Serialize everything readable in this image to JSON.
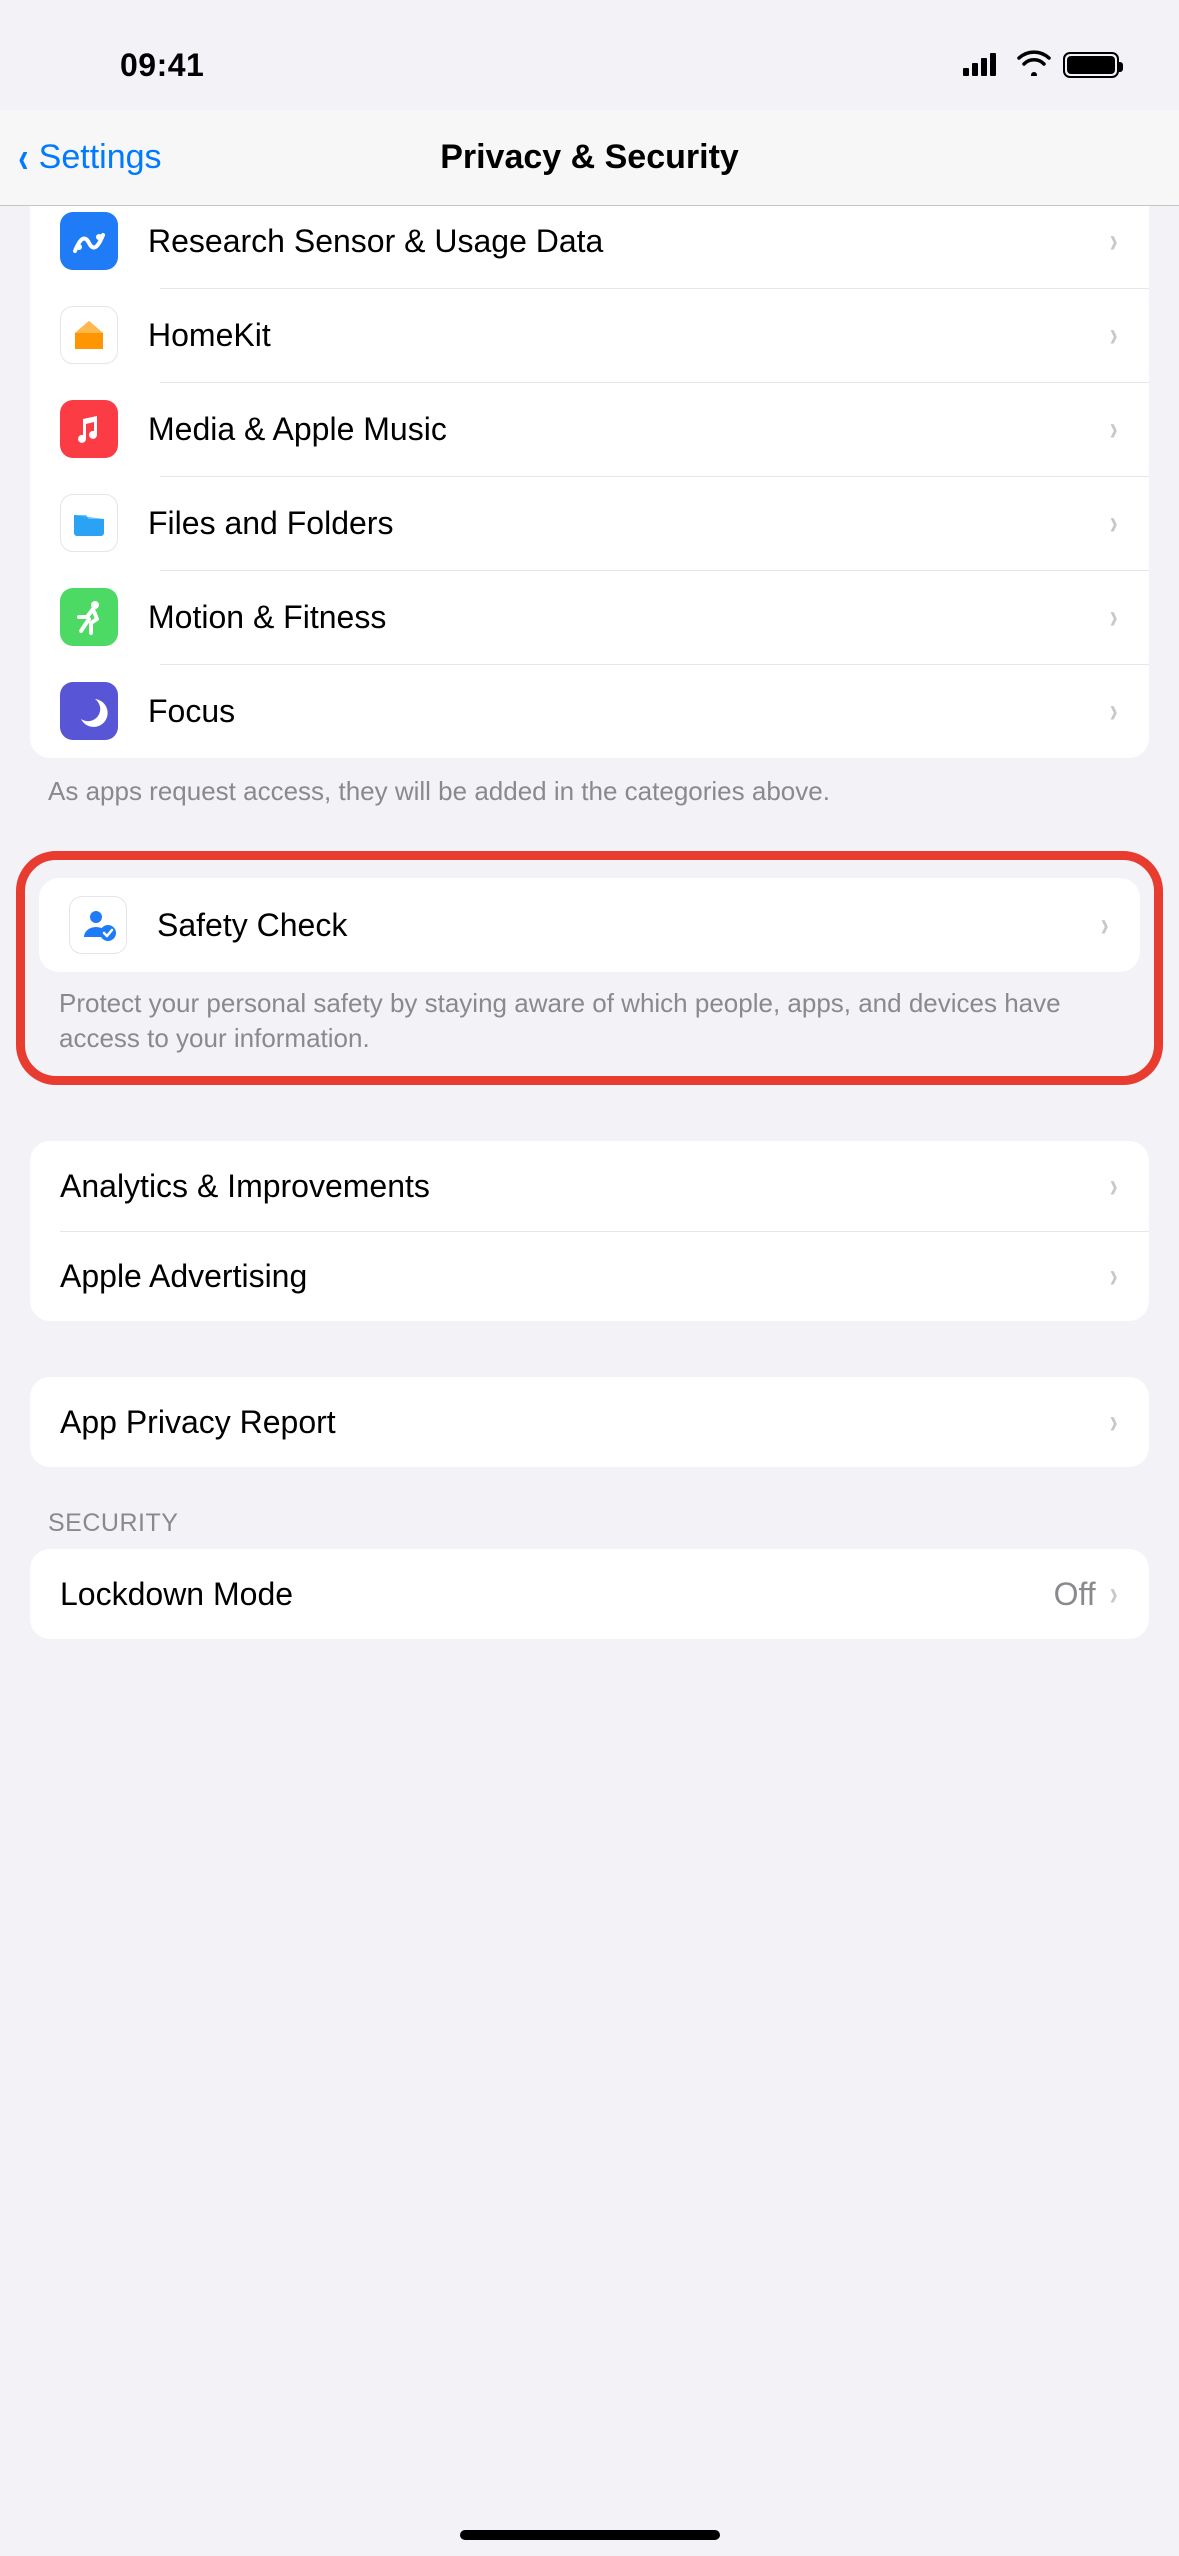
{
  "status": {
    "time": "09:41"
  },
  "nav": {
    "back_label": "Settings",
    "title": "Privacy & Security"
  },
  "group_access": {
    "items": [
      {
        "label": "Research Sensor & Usage Data",
        "icon": "research-sensor-icon"
      },
      {
        "label": "HomeKit",
        "icon": "homekit-icon"
      },
      {
        "label": "Media & Apple Music",
        "icon": "apple-music-icon"
      },
      {
        "label": "Files and Folders",
        "icon": "files-folders-icon"
      },
      {
        "label": "Motion & Fitness",
        "icon": "motion-fitness-icon"
      },
      {
        "label": "Focus",
        "icon": "focus-icon"
      }
    ],
    "footer": "As apps request access, they will be added in the categories above."
  },
  "group_safety": {
    "items": [
      {
        "label": "Safety Check",
        "icon": "safety-check-icon"
      }
    ],
    "footer": "Protect your personal safety by staying aware of which people, apps, and devices have access to your information."
  },
  "group_analytics": {
    "items": [
      {
        "label": "Analytics & Improvements"
      },
      {
        "label": "Apple Advertising"
      }
    ]
  },
  "group_report": {
    "items": [
      {
        "label": "App Privacy Report"
      }
    ]
  },
  "group_security": {
    "header": "Security",
    "items": [
      {
        "label": "Lockdown Mode",
        "value": "Off"
      }
    ]
  }
}
